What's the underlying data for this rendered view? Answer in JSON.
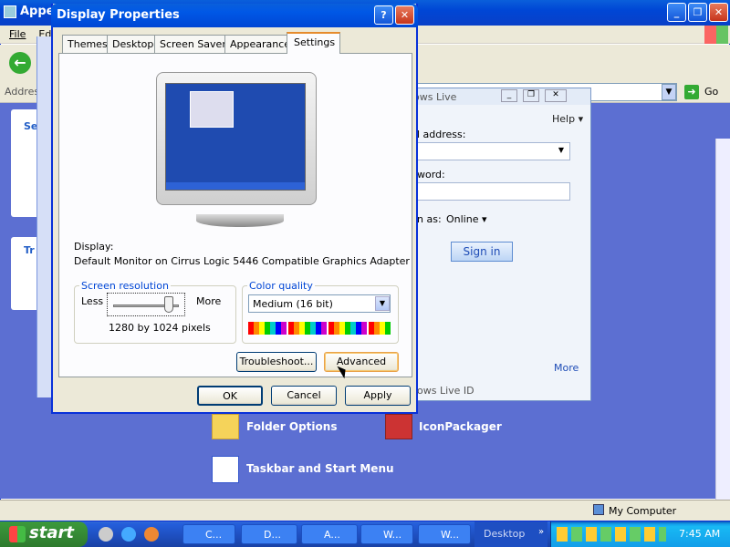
{
  "bg_window": {
    "title": "Appe",
    "menu": [
      "File",
      "Ed"
    ],
    "address_label": "Address",
    "go_label": "Go",
    "left_items": [
      "Se",
      "Tr"
    ]
  },
  "live_window": {
    "title": "ows Live",
    "help": "Help ▾",
    "email_label": "l address:",
    "password_label": "word:",
    "signin_as_label": "n as:",
    "status": "Online ▾",
    "signin_button": "Sign in",
    "more_link": "More",
    "footer": "ows Live ID"
  },
  "control_panel": {
    "items": [
      "Folder Options",
      "IconPackager",
      "Taskbar and Start Menu"
    ]
  },
  "status_bar": {
    "location": "My Computer"
  },
  "dialog": {
    "title": "Display Properties",
    "tabs": [
      "Themes",
      "Desktop",
      "Screen Saver",
      "Appearance",
      "Settings"
    ],
    "active_tab": "Settings",
    "display_label": "Display:",
    "display_value": "Default Monitor on Cirrus Logic 5446 Compatible Graphics Adapter",
    "resolution": {
      "group_label": "Screen resolution",
      "less": "Less",
      "more": "More",
      "value_text": "1280 by 1024 pixels",
      "slider_fraction": 0.85
    },
    "color": {
      "group_label": "Color quality",
      "selected": "Medium (16 bit)"
    },
    "buttons": {
      "troubleshoot": "Troubleshoot...",
      "advanced": "Advanced",
      "ok": "OK",
      "cancel": "Cancel",
      "apply": "Apply"
    }
  },
  "taskbar": {
    "start": "start",
    "tasks": [
      "C...",
      "D...",
      "A...",
      "W...",
      "W..."
    ],
    "desktop_label": "Desktop",
    "clock": "7:45 AM"
  },
  "colors": {
    "xp_blue": "#0046d5",
    "cp_bg": "#5c6fd2",
    "dialog_bg": "#ece9d8",
    "taskbar": "#245edb",
    "start_green": "#3c9a3c"
  }
}
